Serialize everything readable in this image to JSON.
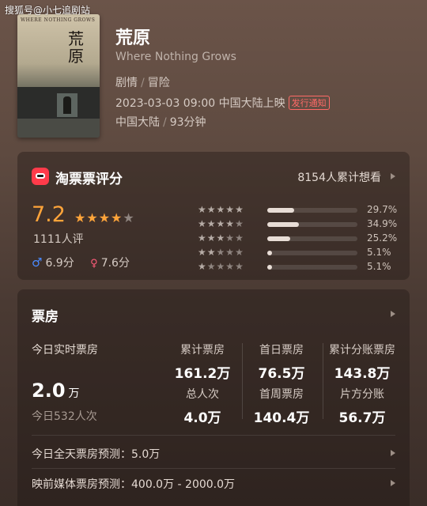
{
  "watermark": "搜狐号@小七追剧站",
  "movie": {
    "title": "荒原",
    "english_title": "Where Nothing Grows",
    "genres": [
      "剧情",
      "冒险"
    ],
    "release": "2023-03-03 09:00 中国大陆上映",
    "release_badge": "发行通知",
    "region": "中国大陆",
    "duration": "93分钟",
    "poster": {
      "en_text": "WHERE NOTHING GROWS",
      "cn_text": "荒原"
    }
  },
  "rating": {
    "title": "淘票票评分",
    "want_see": "8154人累计想看",
    "score": "7.2",
    "stars": 3.5,
    "raters": "1111人评",
    "male_score": "6.9分",
    "female_score": "7.6分",
    "distribution": [
      {
        "stars": 5,
        "percent": 29.7,
        "label": "29.7%"
      },
      {
        "stars": 4,
        "percent": 34.9,
        "label": "34.9%"
      },
      {
        "stars": 3,
        "percent": 25.2,
        "label": "25.2%"
      },
      {
        "stars": 2,
        "percent": 5.1,
        "label": "5.1%"
      },
      {
        "stars": 1,
        "percent": 5.1,
        "label": "5.1%"
      }
    ],
    "colors": {
      "accent": "#ffa43a",
      "logo": "#ff3b4a",
      "male": "#4a8bff",
      "female": "#ff5c7a"
    }
  },
  "box_office": {
    "title": "票房",
    "today_label": "今日实时票房",
    "today_value": "2.0",
    "today_unit": "万",
    "today_people": "今日532人次",
    "stats": [
      {
        "label": "累计票房",
        "value": "161.2万"
      },
      {
        "label": "首日票房",
        "value": "76.5万"
      },
      {
        "label": "累计分账票房",
        "value": "143.8万"
      },
      {
        "label": "总人次",
        "value": "4.0万"
      },
      {
        "label": "首周票房",
        "value": "140.4万"
      },
      {
        "label": "片方分账",
        "value": "56.7万"
      }
    ],
    "forecast_today": "今日全天票房预测：5.0万",
    "forecast_media": "映前媒体票房预测：400.0万 - 2000.0万"
  }
}
